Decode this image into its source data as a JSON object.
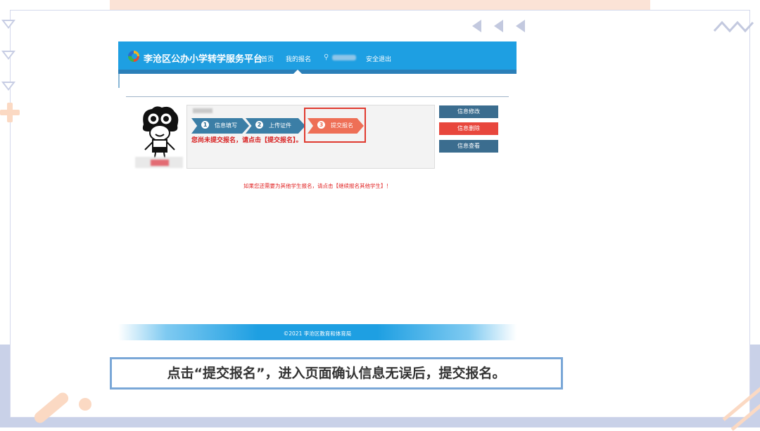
{
  "site": {
    "title": "李沧区公办小学转学服务平台",
    "nav": {
      "home": "首页",
      "my_registration": "我的报名",
      "logout": "安全退出"
    }
  },
  "steps": [
    {
      "number": "1",
      "label": "信息填写"
    },
    {
      "number": "2",
      "label": "上传证件"
    },
    {
      "number": "3",
      "label": "提交报名"
    }
  ],
  "notice": "您尚未提交报名，请点击【提交报名】。",
  "actions": {
    "modify": "信息修改",
    "delete": "信息删除",
    "view": "信息查看"
  },
  "hint": "如果您还需要为其他学生报名，请点击【继续报名其他学生】！",
  "footer": "©2021  李沧区教育和体育局",
  "caption": "点击“提交报名”，进入页面确认信息无误后，提交报名。",
  "colors": {
    "nav_blue": "#1e9fe2",
    "step_blue": "#3b7ea6",
    "step_active": "#ee6f56",
    "delete_red": "#e8473d",
    "caption_border": "#7aa7d7"
  }
}
